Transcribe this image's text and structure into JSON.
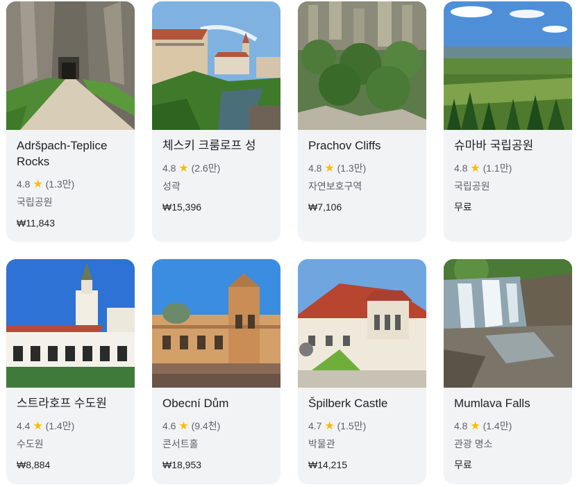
{
  "cards": [
    {
      "title": "Adršpach-Teplice Rocks",
      "rating": "4.8",
      "reviews": "(1.3만)",
      "category": "국립공원",
      "price": "₩11,843"
    },
    {
      "title": "체스키 크룸로프 성",
      "rating": "4.8",
      "reviews": "(2.6만)",
      "category": "성곽",
      "price": "₩15,396"
    },
    {
      "title": "Prachov Cliffs",
      "rating": "4.8",
      "reviews": "(1.3만)",
      "category": "자연보호구역",
      "price": "₩7,106"
    },
    {
      "title": "슈마바 국립공원",
      "rating": "4.8",
      "reviews": "(1.1만)",
      "category": "국립공원",
      "price": "무료"
    },
    {
      "title": "스트라호프 수도원",
      "rating": "4.4",
      "reviews": "(1.4만)",
      "category": "수도원",
      "price": "₩8,884"
    },
    {
      "title": "Obecní Dům",
      "rating": "4.6",
      "reviews": "(9.4천)",
      "category": "콘서트홀",
      "price": "₩18,953"
    },
    {
      "title": "Špilberk Castle",
      "rating": "4.7",
      "reviews": "(1.5만)",
      "category": "박물관",
      "price": "₩14,215"
    },
    {
      "title": "Mumlava Falls",
      "rating": "4.8",
      "reviews": "(1.4만)",
      "category": "관광 명소",
      "price": "무료"
    }
  ],
  "star_icon": "star-icon",
  "colors": {
    "star": "#fbbc04",
    "card_bg": "#f1f3f4",
    "secondary_text": "#5f6368"
  }
}
